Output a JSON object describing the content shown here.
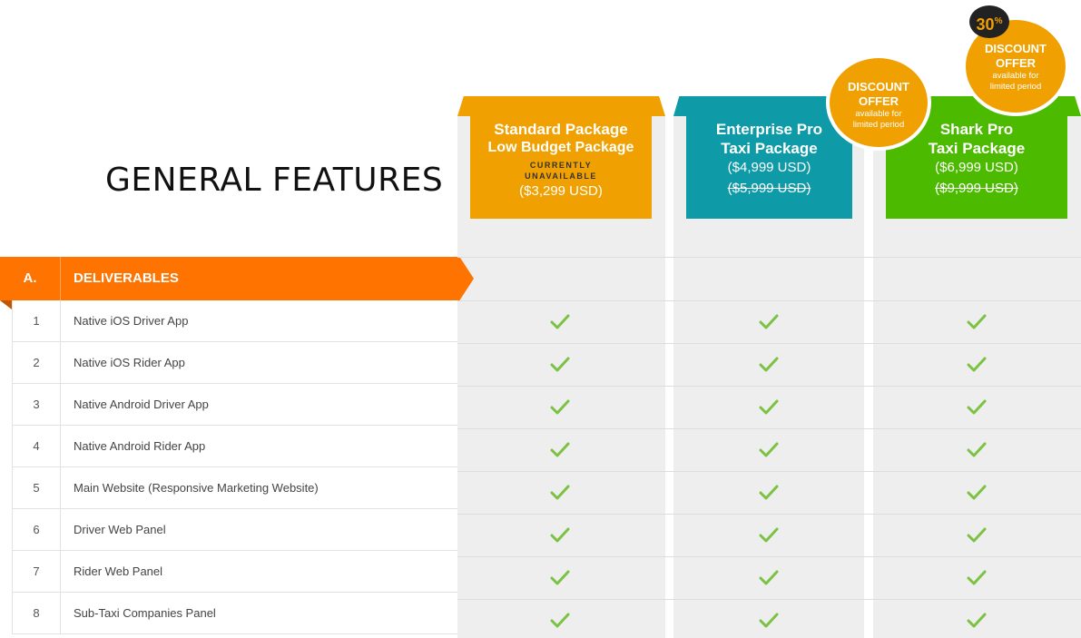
{
  "page_title": "GENERAL FEATURES",
  "packages": [
    {
      "name_line1": "Standard Package",
      "name_line2": "Low Budget Package",
      "status": "CURRENTLY UNAVAILABLE",
      "price": "($3,299 USD)",
      "old_price": "",
      "color": "#f0a000"
    },
    {
      "name_line1": "Enterprise Pro",
      "name_line2": "Taxi Package",
      "status": "",
      "price": "($4,999 USD)",
      "old_price": "($5,999 USD)",
      "color": "#0e9aa7"
    },
    {
      "name_line1": "Shark Pro",
      "name_line2": "Taxi Package",
      "status": "",
      "price": "($6,999 USD)",
      "old_price": "($9,999 USD)",
      "color": "#4cbb00"
    }
  ],
  "offers": [
    {
      "line1": "DISCOUNT",
      "line2": "OFFER",
      "line3": "available for",
      "line4": "limited period"
    },
    {
      "line1": "DISCOUNT",
      "line2": "OFFER",
      "line3": "available for",
      "line4": "limited period",
      "percent": "30",
      "percent_sign": "%"
    }
  ],
  "section": {
    "letter": "A.",
    "label": "DELIVERABLES",
    "color": "#ff7300"
  },
  "features": [
    {
      "num": "1",
      "label": "Native iOS Driver App"
    },
    {
      "num": "2",
      "label": "Native iOS Rider App"
    },
    {
      "num": "3",
      "label": "Native Android Driver App"
    },
    {
      "num": "4",
      "label": "Native Android Rider App"
    },
    {
      "num": "5",
      "label": "Main Website (Responsive Marketing Website)"
    },
    {
      "num": "6",
      "label": "Driver Web Panel"
    },
    {
      "num": "7",
      "label": "Rider Web Panel"
    },
    {
      "num": "8",
      "label": "Sub-Taxi Companies Panel"
    }
  ],
  "icons": {
    "included": "check-icon"
  },
  "check_color": "#7cc242"
}
